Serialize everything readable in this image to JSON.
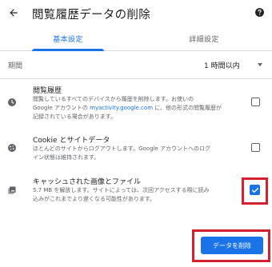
{
  "header": {
    "title": "閲覧履歴データの削除",
    "back_icon": "arrow-back-icon",
    "help_icon": "help-icon"
  },
  "tabs": [
    {
      "label": "基本設定",
      "selected": true
    },
    {
      "label": "詳細設定",
      "selected": false
    }
  ],
  "period": {
    "label": "期間",
    "selected_value": "1 時間以内"
  },
  "items": [
    {
      "title": "閲覧履歴",
      "icon": "clock-icon",
      "desc_line1": "閲覧しているすべてのデバイスから履歴を削除します。お使いの",
      "desc_line2_pre": "Google アカウントの ",
      "desc_line2_link": "myactivity.google.com",
      "desc_line2_post": " に、他の形式の閲覧履歴が",
      "desc_line3": "記録されている場合があります。",
      "checked": false
    },
    {
      "title": "Cookie とサイトデータ",
      "icon": "cookie-icon",
      "desc_line1": "ほとんどのサイトからログアウトします。Google アカウントへのログ",
      "desc_line2": "イン状態は維持されます。",
      "checked": false
    },
    {
      "title": "キャッシュされた画像とファイル",
      "icon": "image-icon",
      "desc_line1": "5.7 MB を解放します。サイトによっては、次回アクセスする際に読み",
      "desc_line2": "込みがこれまでより遅くなる可能性があります。",
      "checked": true
    }
  ],
  "footer": {
    "delete_label": "データを削除"
  },
  "colors": {
    "accent": "#1a73e8",
    "highlight": "#d3202c",
    "text_primary": "#202124",
    "text_secondary": "#5f6368"
  }
}
